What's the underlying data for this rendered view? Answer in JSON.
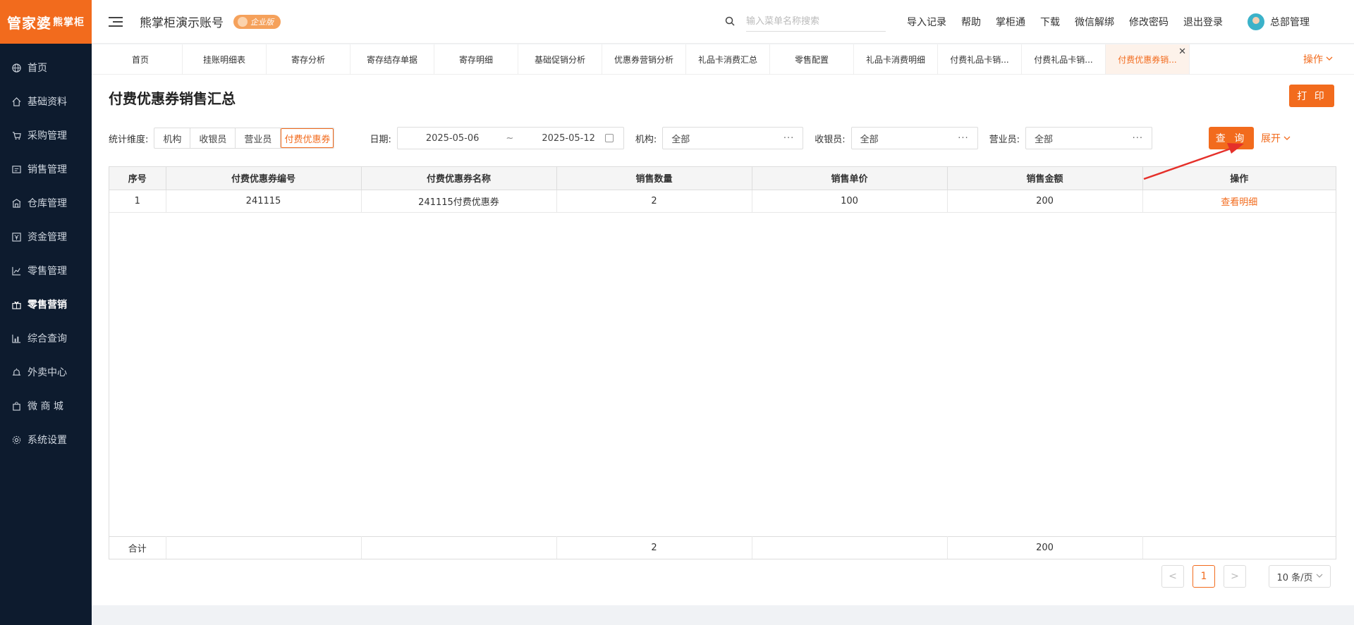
{
  "brand": {
    "logo_main": "管家婆",
    "logo_sub": "熊掌柜"
  },
  "sidebar": {
    "items": [
      {
        "label": "首页",
        "icon": "globe-icon"
      },
      {
        "label": "基础资料",
        "icon": "home-icon"
      },
      {
        "label": "采购管理",
        "icon": "cart-icon"
      },
      {
        "label": "销售管理",
        "icon": "ledger-icon"
      },
      {
        "label": "仓库管理",
        "icon": "warehouse-icon"
      },
      {
        "label": "资金管理",
        "icon": "money-icon"
      },
      {
        "label": "零售管理",
        "icon": "chart-icon"
      },
      {
        "label": "零售营销",
        "icon": "gift-icon",
        "active": true
      },
      {
        "label": "综合查询",
        "icon": "bar-chart-icon"
      },
      {
        "label": "外卖中心",
        "icon": "alarm-icon"
      },
      {
        "label": "微 商 城",
        "icon": "bag-icon"
      },
      {
        "label": "系统设置",
        "icon": "gear-icon"
      }
    ]
  },
  "header": {
    "account": "熊掌柜演示账号",
    "badge": "企业版",
    "search_placeholder": "输入菜单名称搜索",
    "links": [
      "导入记录",
      "帮助",
      "掌柜通",
      "下载",
      "微信解绑",
      "修改密码",
      "退出登录"
    ],
    "user": "总部管理"
  },
  "tabs": {
    "items": [
      "首页",
      "挂账明细表",
      "寄存分析",
      "寄存结存单据",
      "寄存明细",
      "基础促销分析",
      "优惠券营销分析",
      "礼品卡消费汇总",
      "零售配置",
      "礼品卡消费明细",
      "付费礼品卡销...",
      "付费礼品卡销...",
      "付费优惠券销..."
    ],
    "active_index": 12,
    "ops_label": "操作"
  },
  "page": {
    "title": "付费优惠券销售汇总",
    "print_label": "打 印"
  },
  "filters": {
    "dimension_label": "统计维度:",
    "dimensions": [
      "机构",
      "收银员",
      "营业员",
      "付费优惠券"
    ],
    "active_dimension": 3,
    "date_label": "日期:",
    "date_start": "2025-05-06",
    "date_sep": "~",
    "date_end": "2025-05-12",
    "org_label": "机构:",
    "org_value": "全部",
    "cashier_label": "收银员:",
    "cashier_value": "全部",
    "clerk_label": "营业员:",
    "clerk_value": "全部",
    "dots": "···",
    "query_label": "查 询",
    "expand_label": "展开"
  },
  "table": {
    "headers": [
      "序号",
      "付费优惠券编号",
      "付费优惠券名称",
      "销售数量",
      "销售单价",
      "销售金额",
      "操作"
    ],
    "rows": [
      [
        "1",
        "241115",
        "241115付费优惠券",
        "2",
        "100",
        "200",
        "查看明细"
      ]
    ],
    "footer": [
      "合计",
      "",
      "",
      "2",
      "",
      "200",
      ""
    ]
  },
  "pager": {
    "prev": "<",
    "current": "1",
    "next": ">",
    "size": "10 条/页"
  },
  "colors": {
    "accent": "#f26b1d",
    "sidebar_bg": "#0d1b2e",
    "annotation_arrow": "#e5302a"
  }
}
